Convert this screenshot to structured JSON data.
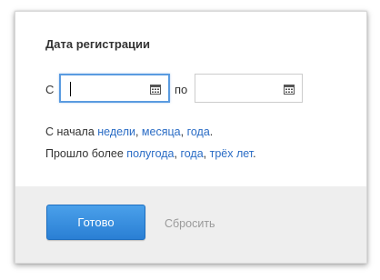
{
  "filter": {
    "title": "Дата регистрации",
    "from_label": "С",
    "to_label": "по",
    "from_value": "",
    "to_value": "",
    "calendar_icon": "calendar-icon"
  },
  "quick_ranges": {
    "since_prefix": "С начала",
    "since_links": [
      "недели",
      "месяца",
      "года"
    ],
    "passed_prefix": "Прошло более",
    "passed_links": [
      "полугода",
      "года",
      "трёх лет"
    ]
  },
  "actions": {
    "done_label": "Готово",
    "reset_label": "Сбросить"
  },
  "colors": {
    "accent": "#2a7fd4",
    "link": "#2a6cc5",
    "focus_border": "#5a9be0",
    "footer_bg": "#eeeeee"
  }
}
